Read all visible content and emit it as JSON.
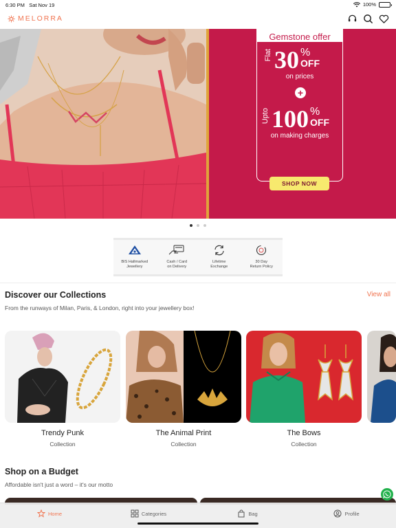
{
  "status_bar": {
    "time": "6:30 PM",
    "date": "Sat Nov 19",
    "battery": "100%"
  },
  "header": {
    "logo": "MELORRA",
    "icons": [
      "support-icon",
      "search-icon",
      "heart-icon"
    ]
  },
  "banner": {
    "title": "Gemstone offer",
    "line1_prefix": "Flat",
    "line1_value": "30",
    "line1_pct": "%",
    "line1_off": "OFF",
    "line1_sub": "on prices",
    "plus": "+",
    "line2_prefix": "Upto",
    "line2_value": "100",
    "line2_pct": "%",
    "line2_off": "OFF",
    "line2_sub": "on making charges",
    "cta": "SHOP NOW",
    "slide_count": 3,
    "active_slide": 1
  },
  "trust": [
    {
      "icon": "bis-hallmark-icon",
      "label": "BIS Hallmarked\nJewellery"
    },
    {
      "icon": "cash-card-icon",
      "label": "Cash / Card\non Delivery"
    },
    {
      "icon": "lifetime-exchange-icon",
      "label": "Lifetime\nExchange"
    },
    {
      "icon": "return-policy-icon",
      "label": "30 Day\nReturn Policy"
    }
  ],
  "collections": {
    "title": "Discover our Collections",
    "view_all": "View all",
    "subtitle": "From the runways of Milan, Paris, & London, right into your jewellery box!",
    "items": [
      {
        "name": "Trendy Punk",
        "type": "Collection"
      },
      {
        "name": "The Animal Print",
        "type": "Collection"
      },
      {
        "name": "The Bows",
        "type": "Collection"
      }
    ]
  },
  "budget": {
    "title": "Shop on a Budget",
    "subtitle": "Affordable isn't just a word – it's our motto"
  },
  "tabbar": [
    {
      "label": "Home",
      "icon": "star-icon",
      "active": true
    },
    {
      "label": "Categories",
      "icon": "grid-icon",
      "active": false
    },
    {
      "label": "Bag",
      "icon": "bag-icon",
      "active": false
    },
    {
      "label": "Profile",
      "icon": "profile-icon",
      "active": false
    }
  ],
  "colors": {
    "brand": "#f07450",
    "banner_red": "#c41a4a",
    "cta_yellow": "#f7e96e"
  }
}
